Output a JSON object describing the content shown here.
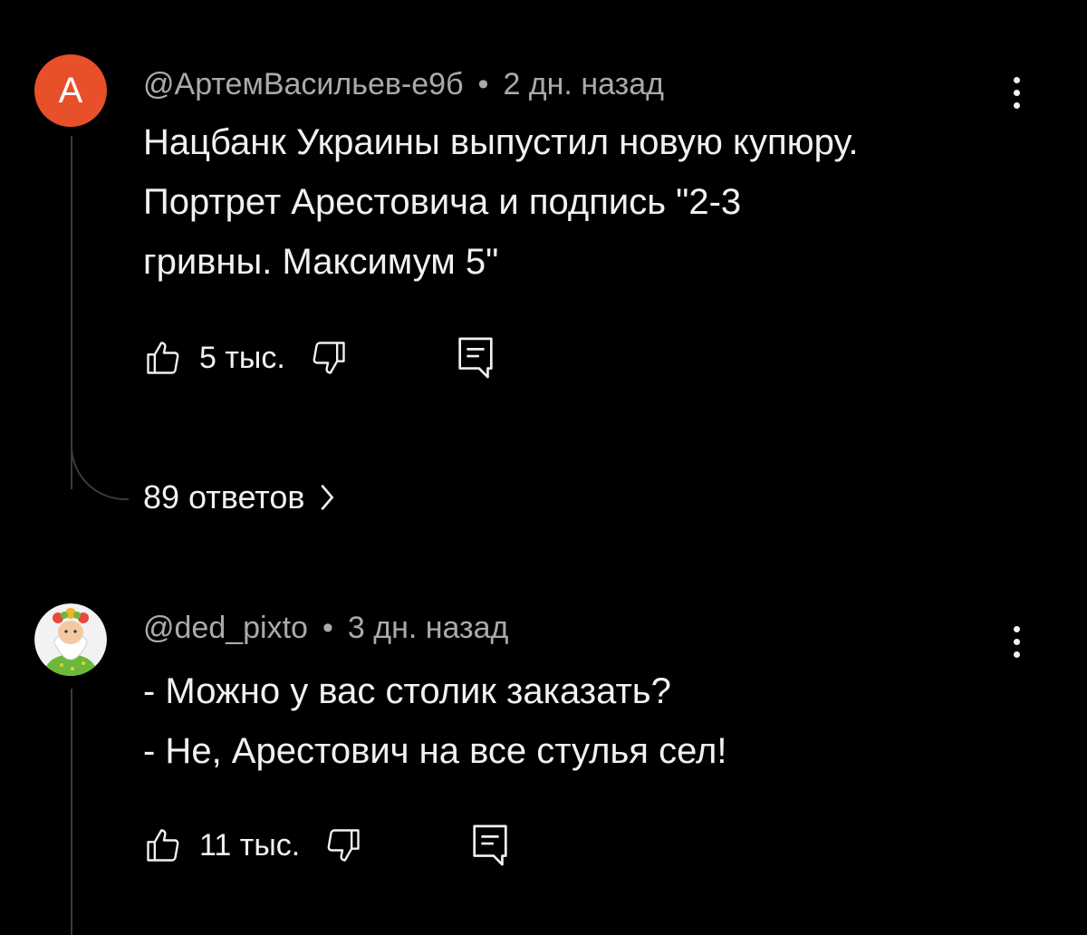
{
  "comments": [
    {
      "avatar_letter": "A",
      "avatar_color": "#e8502a",
      "author": "@АртемВасильев-е9б",
      "separator": "•",
      "time": "2 дн. назад",
      "text_lines": [
        "Нацбанк Украины выпустил новую купюру.",
        "Портрет Арестовича и подпись \"2-3",
        "гривны. Максимум 5\""
      ],
      "likes": "5 тыс.",
      "replies_label": "89 ответов"
    },
    {
      "author": "@ded_pixto",
      "separator": "•",
      "time": "3 дн. назад",
      "text_lines": [
        "- Можно у вас столик заказать?",
        "- Не, Арестович на все стулья сел!"
      ],
      "likes": "11 тыс."
    }
  ],
  "icons": {
    "like": "thumbs-up-icon",
    "dislike": "thumbs-down-icon",
    "reply": "reply-comment-icon",
    "more": "kebab-menu-icon",
    "chevron": "chevron-right-icon"
  }
}
